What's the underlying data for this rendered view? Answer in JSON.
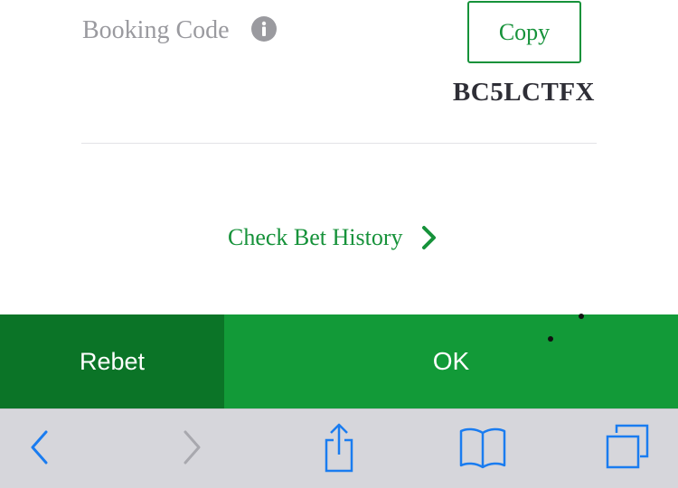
{
  "booking": {
    "label": "Booking Code",
    "copy_label": "Copy",
    "code": "BC5LCTFX"
  },
  "history": {
    "label": "Check Bet History"
  },
  "actions": {
    "rebet_label": "Rebet",
    "ok_label": "OK"
  },
  "toolbar": {
    "items": [
      "back-icon",
      "forward-icon",
      "share-icon",
      "bookmarks-icon",
      "tabs-icon"
    ]
  },
  "colors": {
    "accent": "#16923a",
    "rebet_bg": "#0b7427",
    "ok_bg": "#129a38",
    "toolbar_bg": "#d6d6db",
    "ios_blue": "#1a7cf0"
  }
}
